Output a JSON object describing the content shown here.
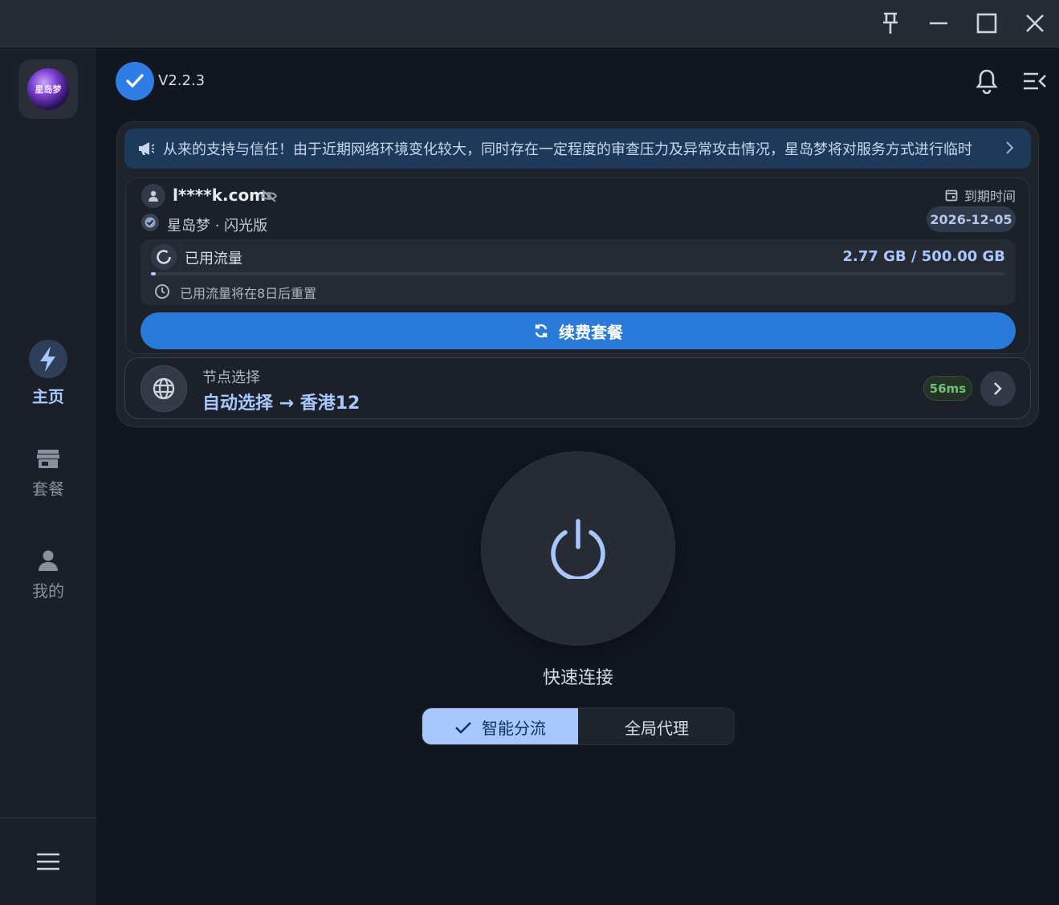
{
  "window": {
    "controls": [
      "pin-icon",
      "minimize-icon",
      "maximize-icon",
      "close-icon"
    ]
  },
  "sidebar": {
    "logo_text": "星岛梦",
    "items": [
      {
        "label": "主页",
        "icon": "lightning-icon",
        "active": true
      },
      {
        "label": "套餐",
        "icon": "store-icon",
        "active": false
      },
      {
        "label": "我的",
        "icon": "person-icon",
        "active": false
      }
    ]
  },
  "header": {
    "version": "V2.2.3"
  },
  "notice": {
    "text": "从来的支持与信任！由于近期网络环境变化较大，同时存在一定程度的审查压力及异常攻击情况，星岛梦将对服务方式进行临时"
  },
  "account": {
    "email": "l****k.com",
    "plan": "星岛梦 · 闪光版",
    "expire_label": "到期时间",
    "expire_date": "2026-12-05"
  },
  "traffic": {
    "label": "已用流量",
    "value": "2.77 GB / 500.00 GB",
    "used_fraction": 0.0055,
    "reset_text": "已用流量将在8日后重置"
  },
  "renew_button": "续费套餐",
  "node": {
    "title": "节点选择",
    "value": "自动选择 → 香港12",
    "latency": "56ms"
  },
  "connect": {
    "label": "快速连接",
    "modes": [
      "智能分流",
      "全局代理"
    ],
    "active_mode": "智能分流"
  },
  "colors": {
    "accent": "#a9c7ff",
    "primary": "#2a7ad9",
    "success": "#6cc27a"
  }
}
